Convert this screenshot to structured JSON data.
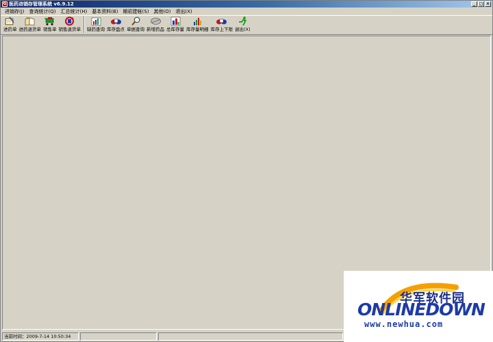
{
  "window": {
    "title": "医药进销存管理系统 v6.9.12",
    "app_icon_text": "G",
    "controls": [
      "_",
      "□",
      "×"
    ]
  },
  "menu": {
    "items": [
      {
        "label": "进销存(J)"
      },
      {
        "label": "查询统计(Q)"
      },
      {
        "label": "汇总统计(H)"
      },
      {
        "label": "基本资料(B)"
      },
      {
        "label": "期初建帐(S)"
      },
      {
        "label": "其他(O)"
      },
      {
        "label": "退出(X)"
      }
    ]
  },
  "toolbar": {
    "buttons": [
      {
        "label": "进药单",
        "icon": "notebook-pen-icon"
      },
      {
        "label": "进药退货单",
        "icon": "open-book-icon"
      },
      {
        "label": "销售单",
        "icon": "cart-icon"
      },
      {
        "label": "销售退货单",
        "icon": "return-arrow-icon"
      },
      {
        "label": "缺药查询",
        "icon": "chart-icon"
      },
      {
        "label": "库存盘点",
        "icon": "boxes-icon"
      },
      {
        "label": "单据查询",
        "icon": "magnifier-icon"
      },
      {
        "label": "新增药品",
        "icon": "pill-icon"
      },
      {
        "label": "总库存量",
        "icon": "stock-chart-icon"
      },
      {
        "label": "库存量明细",
        "icon": "bar-chart-icon"
      },
      {
        "label": "库存上下限",
        "icon": "boxes-icon"
      },
      {
        "label": "退出(X)",
        "icon": "running-man-icon"
      }
    ],
    "colors": {
      "accent_red": "#c8102e",
      "accent_blue": "#1e3aa8",
      "accent_green": "#1a9a1a"
    }
  },
  "status": {
    "time_label": "当前时间：",
    "time_value": "2009-7-14 10:50:34"
  },
  "watermark": {
    "cn": "华军软件园",
    "en": "ONLINEDOWN",
    "url": "www.newhua.com"
  }
}
